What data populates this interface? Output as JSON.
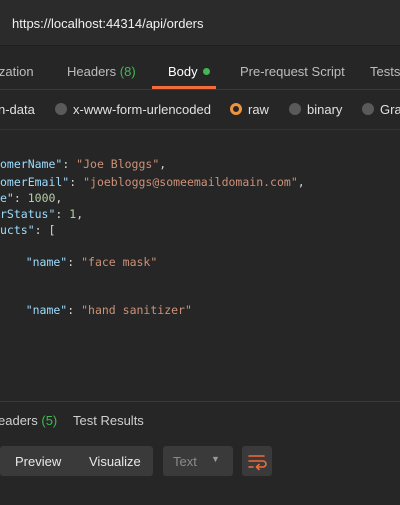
{
  "request": {
    "url": "https://localhost:44314/api/orders"
  },
  "request_tabs": [
    {
      "label": "ization"
    },
    {
      "label": "Headers",
      "count": "(8)"
    },
    {
      "label": "Body"
    },
    {
      "label": "Pre-request Script"
    },
    {
      "label": "Tests"
    }
  ],
  "body_types": {
    "form_data": "n-data",
    "urlencoded": "x-www-form-urlencoded",
    "raw": "raw",
    "binary": "binary",
    "graphql": "Gra"
  },
  "editor": {
    "lines": [
      {
        "k": "omerName\"",
        "v": "\"Joe Bloggs\"",
        "vt": "str",
        "tail": ","
      },
      {
        "k": "omerEmail\"",
        "v": "\"joebloggs@someemaildomain.com\"",
        "vt": "str",
        "tail": ","
      },
      {
        "k": "e\"",
        "v": "1000",
        "vt": "num",
        "tail": ","
      },
      {
        "k": "rStatus\"",
        "v": "1",
        "vt": "num",
        "tail": ","
      },
      {
        "k": "ucts\"",
        "v": "[",
        "vt": "pun",
        "tail": ""
      },
      {
        "k": "",
        "v": "",
        "vt": "pun",
        "tail": ""
      },
      {
        "k": "    \"name\"",
        "v": "\"face mask\"",
        "vt": "str",
        "tail": ""
      },
      {
        "k": "",
        "v": "",
        "vt": "pun",
        "tail": ","
      },
      {
        "k": "",
        "v": "",
        "vt": "pun",
        "tail": ""
      },
      {
        "k": "    \"name\"",
        "v": "\"hand sanitizer\"",
        "vt": "str",
        "tail": ""
      }
    ]
  },
  "response_tabs": [
    {
      "label": "eaders",
      "count": "(5)"
    },
    {
      "label": "Test Results"
    }
  ],
  "response_toolbar": {
    "preview": "Preview",
    "visualize": "Visualize",
    "format": "Text"
  },
  "colors": {
    "accent": "#f26b3a",
    "green": "#3fb950",
    "radio_selected": "#f0943a"
  }
}
